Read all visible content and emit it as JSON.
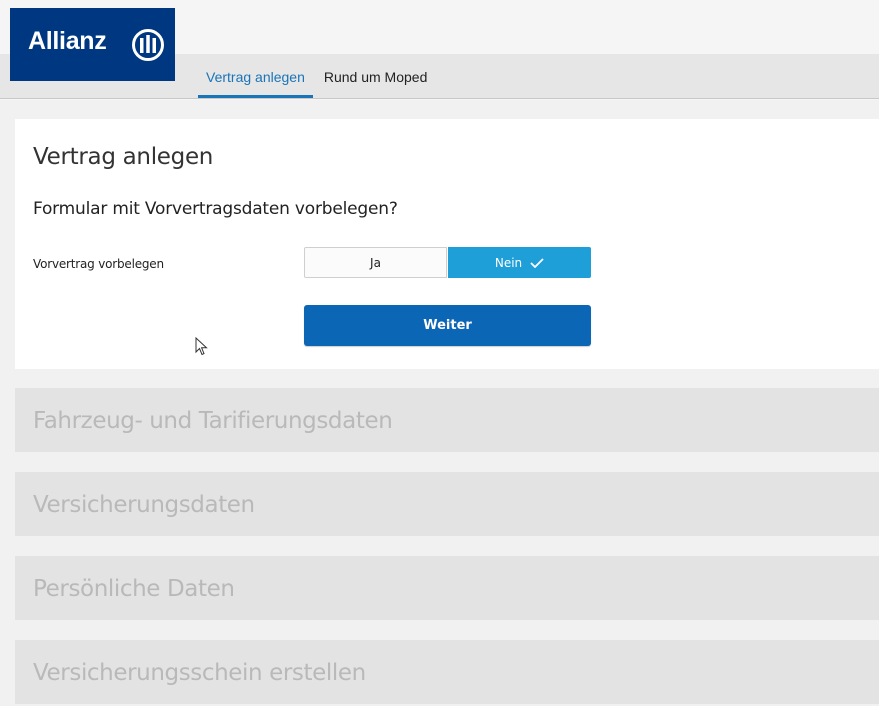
{
  "brand": {
    "name": "Allianz",
    "color": "#003781"
  },
  "nav": {
    "tabs": [
      {
        "label": "Vertrag anlegen",
        "active": true
      },
      {
        "label": "Rund um Moped",
        "active": false
      }
    ],
    "accent": "#1a74b8"
  },
  "form": {
    "title": "Vertrag anlegen",
    "question": "Formular mit Vorvertragsdaten vorbelegen?",
    "field_label": "Vorvertrag vorbelegen",
    "options": [
      {
        "label": "Ja",
        "selected": false
      },
      {
        "label": "Nein",
        "selected": true,
        "icon": "check-icon"
      }
    ],
    "submit_label": "Weiter",
    "selected_color": "#1e9fd8",
    "button_color": "#0c66b6"
  },
  "sections": [
    "Fahrzeug- und Tarifierungsdaten",
    "Versicherungsdaten",
    "Persönliche Daten",
    "Versicherungsschein erstellen"
  ]
}
